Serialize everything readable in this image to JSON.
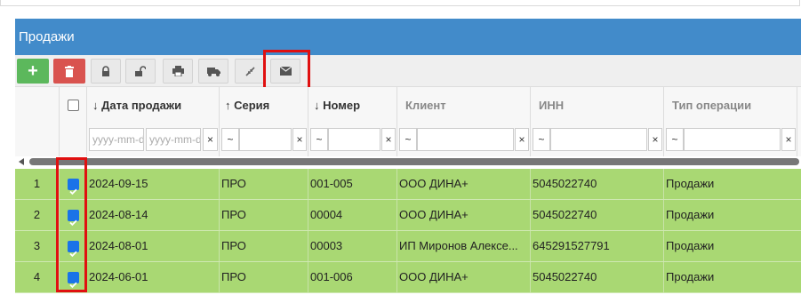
{
  "panel_title": "Продажи",
  "toolbar": {
    "add_icon": "plus-icon",
    "delete_icon": "trash-icon",
    "buttons": [
      "lock-icon",
      "unlock-icon",
      "print-icon",
      "truck-icon",
      "collapse-icon",
      "envelope-icon"
    ]
  },
  "columns": {
    "date": "Дата продажи",
    "series": "Серия",
    "number": "Номер",
    "client": "Клиент",
    "inn": "ИНН",
    "optype": "Тип операции",
    "sort_down": "↓",
    "sort_up": "↑"
  },
  "filters": {
    "date_from_placeholder": "yyyy-mm-dd",
    "date_to_placeholder": "yyyy-mm-dd",
    "op": "~",
    "clear": "×"
  },
  "rows": [
    {
      "n": "1",
      "date": "2024-09-15",
      "series": "ПРО",
      "number": "001-005",
      "client": "ООО ДИНА+",
      "inn": "5045022740",
      "optype": "Продажи"
    },
    {
      "n": "2",
      "date": "2024-08-14",
      "series": "ПРО",
      "number": "00004",
      "client": "ООО ДИНА+",
      "inn": "5045022740",
      "optype": "Продажи"
    },
    {
      "n": "3",
      "date": "2024-08-01",
      "series": "ПРО",
      "number": "00003",
      "client": "ИП Миронов Алексе...",
      "inn": "645291527791",
      "optype": "Продажи"
    },
    {
      "n": "4",
      "date": "2024-06-01",
      "series": "ПРО",
      "number": "001-006",
      "client": "ООО ДИНА+",
      "inn": "5045022740",
      "optype": "Продажи"
    }
  ],
  "colors": {
    "header": "#428bca",
    "row_selected": "#a9d873",
    "add": "#5cb85c",
    "delete": "#d9534f",
    "highlight": "#e01010"
  }
}
